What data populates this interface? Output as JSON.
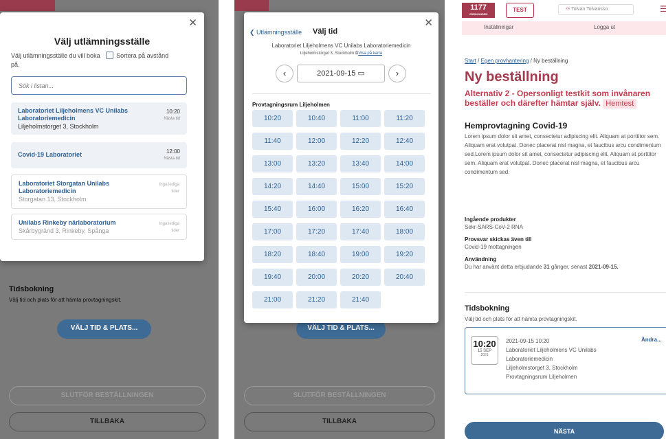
{
  "colors": {
    "brand": "#a33a4d",
    "primary": "#2c5f94",
    "slot_bg": "#dde8f3"
  },
  "panel1": {
    "title": "Välj utlämningsställe",
    "desc": "Välj utlämningsställe du vill boka",
    "sort_label": "Sortera på avstånd",
    "desc_tail": "på.",
    "search_placeholder": "Sök i listan...",
    "locations": [
      {
        "name": "Laboratoriet Liljeholmens VC Unilabs Laboratoriemedicin",
        "address": "Liljeholmstorget 3, Stockholm",
        "time": "10:20",
        "time_note": "Nästa tid"
      },
      {
        "name": "Covid-19 Laboratoriet",
        "address": "",
        "time": "12:00",
        "time_note": "Nästa tid"
      },
      {
        "name": "Laboratoriet Storgatan Unilabs Laboratoriemedicin",
        "address": "Storgatan 13, Stockholm",
        "time": "",
        "time_note": "Inga lediga tider"
      },
      {
        "name": "Unilabs Rinkeby närlaboratorium",
        "address": "Skårbygränd 3, Rinkeby, Spånga",
        "time": "",
        "time_note": "Inga lediga tider"
      }
    ],
    "booking_title": "Tidsbokning",
    "booking_desc": "Välj tid och plats för att hämta provtagningskit.",
    "choose_btn": "VÄLJ TID & PLATS...",
    "finish_btn": "SLUTFÖR BESTÄLLNINGEN",
    "back_btn": "TILLBAKA"
  },
  "panel2": {
    "back_link": "Utlämningsställe",
    "title": "Välj tid",
    "location": "Laboratoriet Liljeholmens VC Unilabs Laboratoriemedicin",
    "address": "Liljeholmstorget 3, Stockholm",
    "map_link": "Visa på karta",
    "date": "2021-09-15",
    "room": "Provtagningsrum Liljeholmen",
    "slots": [
      "10:20",
      "10:40",
      "11:00",
      "11:20",
      "11:40",
      "12:00",
      "12:20",
      "12:40",
      "13:00",
      "13:20",
      "13:40",
      "14:00",
      "14:20",
      "14:40",
      "15:00",
      "15:20",
      "15:40",
      "16:00",
      "16:20",
      "16:40",
      "17:00",
      "17:20",
      "17:40",
      "18:00",
      "18:20",
      "18:40",
      "19:00",
      "19:20",
      "19:40",
      "20:00",
      "20:20",
      "20:40",
      "21:00",
      "21:20",
      "21:40"
    ],
    "choose_btn": "VÄLJ TID & PLATS...",
    "finish_btn": "SLUTFÖR BESTÄLLNINGEN",
    "back_btn": "TILLBAKA"
  },
  "panel3": {
    "logo": "1177",
    "logo_sub": "VÅRDGUIDEN",
    "test_badge": "TEST",
    "user": "Tolvan Tolvansso",
    "settings": "Inställningar",
    "logout": "Logga ut",
    "crumb_start": "Start",
    "crumb_own": "Egen provhantering",
    "crumb_current": "Ny beställning",
    "heading": "Ny beställning",
    "alt": "Alternativ 2 - Opersonligt testkit som invånaren beställer och därefter hämtar själv.",
    "hemtest": "Hemtest",
    "section": "Hemprovtagning Covid-19",
    "lorem": "Lorem ipsum dolor sit amet, consectetur adipiscing elit. Aliquam at porttitor sem. Aliquam erat volutpat. Donec placerat nisl magna, et faucibus arcu condimentum sed.Lorem ipsum dolor sit amet, consectetur adipiscing elit. Aliquam at porttitor sem. Aliquam erat volutpat. Donec placerat nisl magna, et faucibus arcu condimentum sed.",
    "products_label": "Ingående produkter",
    "products_value": "Sekr-SARS-CoV-2 RNA",
    "answer_label": "Provsvar skickas även till",
    "answer_value": "Covid-19 mottagningen",
    "usage_label": "Användning",
    "usage_pre": "Du har använt detta erbjudande",
    "usage_count": "31",
    "usage_mid": "gånger, senast",
    "usage_date": "2021-09-15.",
    "booking_title": "Tidsbokning",
    "booking_desc": "Välj tid och plats för att hämta provtagningskit.",
    "cal_time": "10:20",
    "cal_day": "15 SEP",
    "cal_year": "2021",
    "book_datetime": "2021-09-15 10:20",
    "book_loc1": "Laboratoriet Liljeholmens VC Unilabs",
    "book_loc2": "Laboratoriemedicin",
    "book_addr": "Liljeholmstorget 3, Stockholm",
    "book_room": "Provtagningsrum Liljeholmen",
    "change": "Ändra...",
    "next": "NÄSTA"
  }
}
